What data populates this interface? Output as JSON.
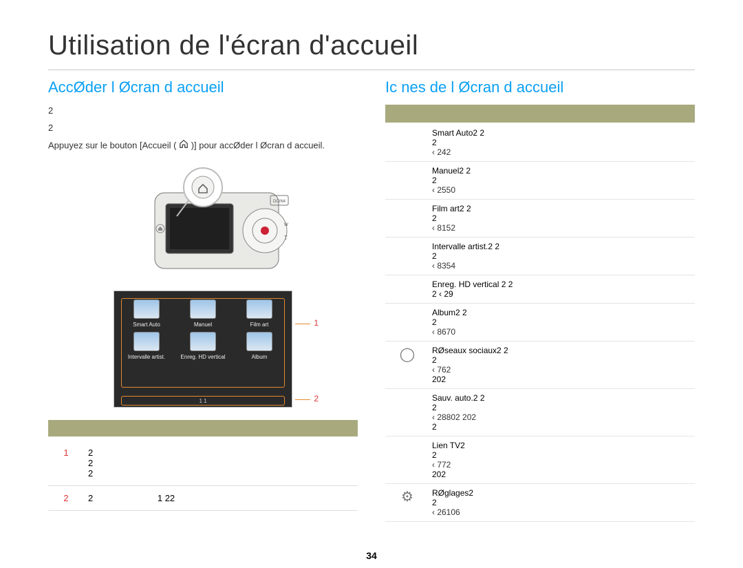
{
  "page_title": "Utilisation de l'écran d'accueil",
  "page_number": "34",
  "left": {
    "heading": "AccØder   l Øcran d accueil",
    "p1": "2",
    "p2": "2",
    "instr_prefix": "Appuyez sur le bouton [Accueil (",
    "instr_suffix": ")] pour accØder   l Øcran d accueil.",
    "ui_items": [
      "Smart Auto",
      "Manuel",
      "Film art",
      "Intervalle artist.",
      "Enreg. HD vertical",
      "Album"
    ],
    "ui_page_indicator": "1 1",
    "annot1": "1",
    "annot2": "2",
    "rows": [
      {
        "n": "1",
        "c1": "2",
        "c2": "2",
        "c3": "2"
      },
      {
        "n": "2",
        "c1": "2",
        "c2": "",
        "c3": "1  22"
      }
    ]
  },
  "right": {
    "heading": "Ic nes de l Øcran d accueil",
    "items": [
      {
        "icon": "",
        "title": "Smart Auto2  2",
        "line2": "2",
        "ref": "‹ 242"
      },
      {
        "icon": "",
        "title": "Manuel2  2",
        "line2": "2",
        "ref": "‹ 2550"
      },
      {
        "icon": "",
        "title": "Film art2  2",
        "line2": "2",
        "ref": "‹ 8152"
      },
      {
        "icon": "",
        "title": "Intervalle artist.2  2",
        "line2": "2",
        "ref": "‹ 8354"
      },
      {
        "icon": "",
        "title": "Enreg. HD vertical 2  2",
        "line2": "2        ‹ 29",
        "ref": ""
      },
      {
        "icon": "",
        "title": "Album2  2",
        "line2": "2",
        "ref": "‹ 8670"
      },
      {
        "icon": "◯",
        "title": "RØseaux sociaux2  2",
        "line2": "2",
        "ref": "‹ 762",
        "extra": "202"
      },
      {
        "icon": "",
        "title": "Sauv. auto.2 2",
        "line2": "2",
        "ref": "‹ 28802      202",
        "extra": "2"
      },
      {
        "icon": "",
        "title": "Lien TV2",
        "line2": "2",
        "ref": "‹ 772",
        "extra": "202"
      },
      {
        "icon": "⚙",
        "title": "RØglages2",
        "line2": "2",
        "ref": "‹ 26106"
      }
    ]
  }
}
